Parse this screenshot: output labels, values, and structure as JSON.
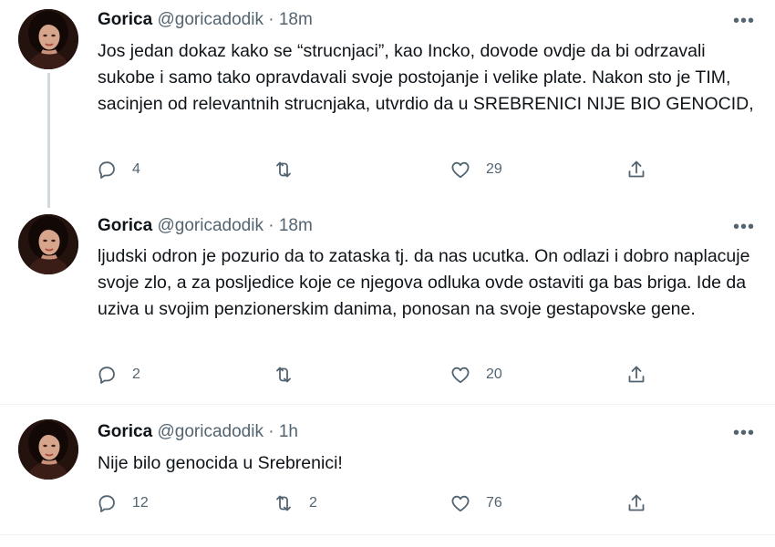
{
  "tweets": [
    {
      "name": "Gorica",
      "handle": "@goricadodik",
      "separator": "·",
      "time": "18m",
      "text": "Jos jedan dokaz kako se “strucnjaci”, kao Incko, dovode ovdje da bi odrzavali sukobe i samo tako opravdavali svoje postojanje i velike plate. Nakon sto je TIM, sacinjen od relevantnih strucnjaka, utvrdio da u SREBRENICI NIJE BIO GENOCID,",
      "replies": "4",
      "retweets": "",
      "likes": "29"
    },
    {
      "name": "Gorica",
      "handle": "@goricadodik",
      "separator": "·",
      "time": "18m",
      "text": "ljudski odron je pozurio da to zataska tj. da nas ucutka. On odlazi i dobro naplacuje svoje zlo, a za posljedice koje ce njegova odluka ovde ostaviti ga bas briga. Ide da uziva u svojim penzionerskim danima, ponosan na svoje gestapovske gene.",
      "replies": "2",
      "retweets": "",
      "likes": "20"
    },
    {
      "name": "Gorica",
      "handle": "@goricadodik",
      "separator": "·",
      "time": "1h",
      "text": "Nije bilo genocida u Srebrenici!",
      "replies": "12",
      "retweets": "2",
      "likes": "76"
    }
  ],
  "more_glyph": "•••",
  "icons": {
    "reply": "reply-icon",
    "retweet": "retweet-icon",
    "like": "heart-icon",
    "share": "share-icon",
    "more": "more-icon"
  },
  "colors": {
    "text": "#0f1419",
    "secondary": "#536471",
    "thread_line": "#cfd9de",
    "divider": "#eff3f4"
  }
}
